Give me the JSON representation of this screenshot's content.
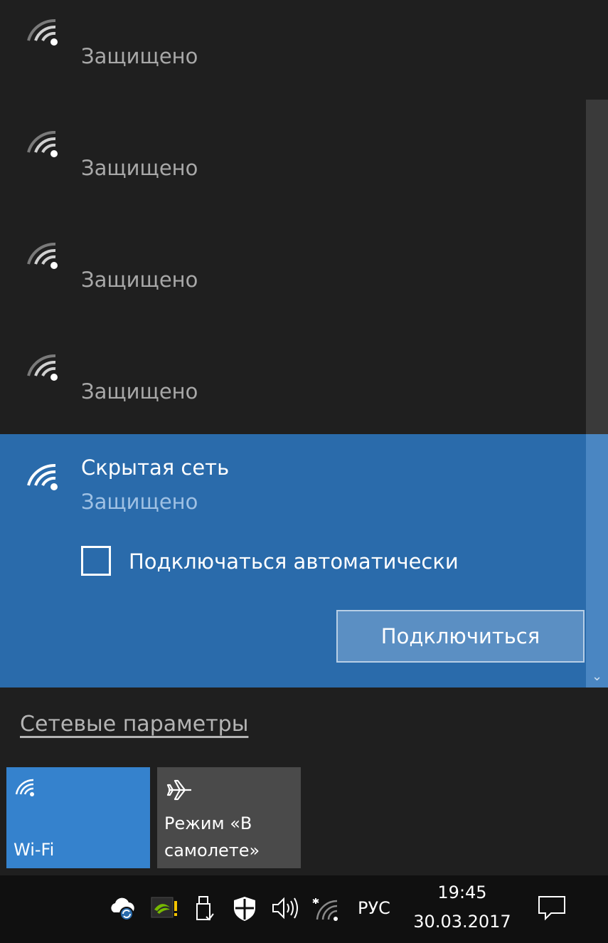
{
  "networks": [
    {
      "status": "Защищено"
    },
    {
      "status": "Защищено"
    },
    {
      "status": "Защищено"
    },
    {
      "status": "Защищено"
    }
  ],
  "selected_network": {
    "name": "Скрытая сеть",
    "status": "Защищено",
    "auto_connect_label": "Подключаться автоматически",
    "auto_connect_checked": false,
    "connect_button": "Подключиться"
  },
  "settings_link": "Сетевые параметры",
  "quick_actions": {
    "wifi_label": "Wi-Fi",
    "airplane_label_line1": "Режим «В",
    "airplane_label_line2": "самолете»"
  },
  "taskbar": {
    "language": "РУС",
    "time": "19:45",
    "date": "30.03.2017"
  },
  "colors": {
    "panel_bg": "#1f1f1f",
    "selected_bg": "#2a6bab",
    "wifi_tile": "#3582cd",
    "airplane_tile": "#4a4a4a",
    "taskbar_bg": "#101010"
  }
}
